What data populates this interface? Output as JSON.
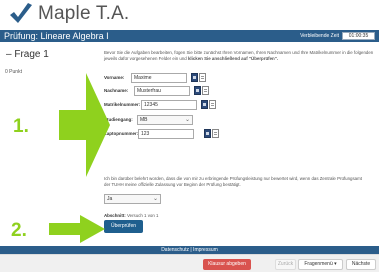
{
  "app": {
    "name": "Maple T.A."
  },
  "header": {
    "title": "Prüfung: Lineare Algebra I",
    "timer_label": "Verbleibende Zeit",
    "timer_value": "01:00:35"
  },
  "question": {
    "title": "Frage 1",
    "points": "0 Punkt",
    "intro_plain": "Bevor Sie die Aufgaben bearbeiten, fügen Sie bitte zunächst Ihren Vornamen, Ihren Nachnamen und Ihre Matrikelnummer in die folgenden jeweils dafür vorgesehenen Felder ein und ",
    "intro_bold": "klicken Sie anschließend auf \"Überprüfen\"."
  },
  "form": {
    "vorname": {
      "label": "Vorname:",
      "value": "Maxime"
    },
    "nachname": {
      "label": "Nachname:",
      "value": "Musterfrau"
    },
    "matrikel": {
      "label": "Matrikelnummer:",
      "value": "12345"
    },
    "studiengang": {
      "label": "Studiengang:",
      "value": "MB"
    },
    "laptop": {
      "label": "Laptopnummer:",
      "value": "123"
    }
  },
  "consent": {
    "text": "Ich bin darüber belehrt worden, dass die von mir zu erbringende Prüfungsleistung nur bewertet wird, wenn das Zentrale Prüfungsamt der TUHH meine offizielle Zulassung vor Beginn der Prüfung bestätigt.",
    "select_value": "Ja"
  },
  "section": {
    "label": "Abschnitt:",
    "attempt": "Versuch 1 von 1"
  },
  "check_button": "Überprüfen",
  "markers": {
    "one": "1.",
    "two": "2."
  },
  "footer": {
    "text": "Datenschutz | Impressum"
  },
  "bottom": {
    "submit": "Klausur abgeben",
    "back": "Zurück",
    "menu": "Fragenmenü ▾",
    "next": "Nächste"
  },
  "colors": {
    "header": "#2b5d8a",
    "marker_arrow": "#8fd11e",
    "submit_button": "#d9534f",
    "check_button": "#1f5f8e"
  }
}
